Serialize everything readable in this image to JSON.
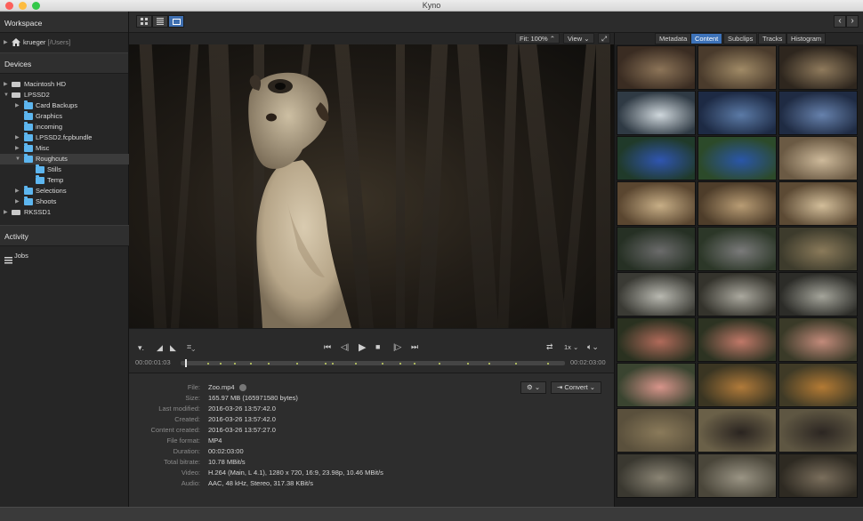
{
  "window": {
    "title": "Kyno"
  },
  "sidebar": {
    "workspace_header": "Workspace",
    "workspace_user": "krueger",
    "workspace_path": "[/Users]",
    "devices_header": "Devices",
    "devices": [
      {
        "label": "Macintosh HD"
      },
      {
        "label": "LPSSD2"
      },
      {
        "label": "Card Backups"
      },
      {
        "label": "Graphics"
      },
      {
        "label": "incoming"
      },
      {
        "label": "LPSSD2.fcpbundle"
      },
      {
        "label": "Misc"
      },
      {
        "label": "Roughcuts"
      },
      {
        "label": "Stills"
      },
      {
        "label": "Temp"
      },
      {
        "label": "Selections"
      },
      {
        "label": "Shoots"
      },
      {
        "label": "RKSSD1"
      }
    ],
    "activity_header": "Activity",
    "jobs_label": "Jobs"
  },
  "player": {
    "fit_label": "Fit: 100%",
    "view_label": "View",
    "current_time": "00:00:01:03",
    "end_time": "00:02:03:00",
    "speed_label": "1x",
    "progress": 0.012
  },
  "info": {
    "rows": [
      {
        "key": "File:",
        "value": "Zoo.mp4"
      },
      {
        "key": "Size:",
        "value": "165.97 MB (165971580 bytes)"
      },
      {
        "key": "Last modified:",
        "value": "2016-03-26 13:57:42.0"
      },
      {
        "key": "Created:",
        "value": "2016-03-26 13:57:42.0"
      },
      {
        "key": "Content created:",
        "value": "2016-03-26 13:57:27.0"
      },
      {
        "key": "File format:",
        "value": "MP4"
      },
      {
        "key": "Duration:",
        "value": "00:02:03:00"
      },
      {
        "key": "Total bitrate:",
        "value": "10.78 MBit/s"
      },
      {
        "key": "Video:",
        "value": "H.264 (Main, L 4.1), 1280 x 720, 16:9, 23.98p, 10.46 MBit/s"
      },
      {
        "key": "Audio:",
        "value": "AAC, 48 kHz, Stereo, 317.38 KBit/s"
      }
    ],
    "convert_label": "Convert"
  },
  "right_panel": {
    "tabs": [
      "Metadata",
      "Content",
      "Subclips",
      "Tracks",
      "Histogram"
    ],
    "active_tab": "Content"
  },
  "colors": {
    "accent": "#3d72b8",
    "folder": "#5db6ef",
    "tick": "#a8b35c"
  }
}
